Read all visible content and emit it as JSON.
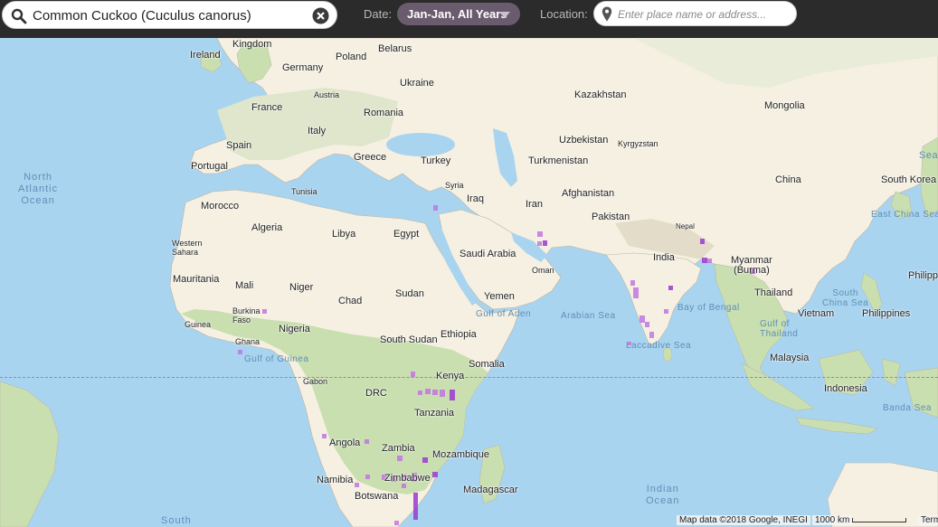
{
  "toolbar": {
    "species_value": "Common Cuckoo (Cuculus canorus)",
    "date_label": "Date:",
    "date_value": "Jan-Jan, All Years",
    "location_label": "Location:",
    "location_placeholder": "Enter place name or address..."
  },
  "map": {
    "labels": {
      "kingdom": "Kingdom",
      "ireland": "Ireland",
      "poland": "Poland",
      "belarus": "Belarus",
      "germany": "Germany",
      "ukraine": "Ukraine",
      "austria": "Austria",
      "kazakhstan": "Kazakhstan",
      "mongolia": "Mongolia",
      "france": "France",
      "romania": "Romania",
      "italy": "Italy",
      "uzbekistan": "Uzbekistan",
      "kyrgyzstan": "Kyrgyzstan",
      "spain": "Spain",
      "turkmenistan": "Turkmenistan",
      "portugal": "Portugal",
      "greece": "Greece",
      "turkey": "Turkey",
      "china": "China",
      "south_korea": "South Korea",
      "syria": "Syria",
      "tunisia": "Tunisia",
      "iraq": "Iraq",
      "afghanistan": "Afghanistan",
      "morocco": "Morocco",
      "iran": "Iran",
      "pakistan": "Pakistan",
      "algeria": "Algeria",
      "libya": "Libya",
      "egypt": "Egypt",
      "nepal": "Nepal",
      "western_sahara": "Western\nSahara",
      "saudi_arabia": "Saudi Arabia",
      "india": "India",
      "myanmar": "Myanmar\n(Burma)",
      "oman": "Oman",
      "mauritania": "Mauritania",
      "mali": "Mali",
      "niger": "Niger",
      "chad": "Chad",
      "sudan": "Sudan",
      "yemen": "Yemen",
      "thailand": "Thailand",
      "burkina_faso": "Burkina\nFaso",
      "nigeria": "Nigeria",
      "guinea": "Guinea",
      "vietnam": "Vietnam",
      "philippines": "Philippines",
      "ghana": "Ghana",
      "south_sudan": "South Sudan",
      "ethiopia": "Ethiopia",
      "somalia": "Somalia",
      "malaysia": "Malaysia",
      "gabon": "Gabon",
      "kenya": "Kenya",
      "drc": "DRC",
      "indonesia": "Indonesia",
      "tanzania": "Tanzania",
      "angola": "Angola",
      "zambia": "Zambia",
      "mozambique": "Mozambique",
      "namibia": "Namibia",
      "zimbabwe": "Zimbabwe",
      "madagascar": "Madagascar",
      "botswana": "Botswana",
      "philipp_edge": "Philipp",
      "sea_edge": "Sea"
    },
    "water_labels": {
      "north_atlantic": "North\nAtlantic\nOcean",
      "east_china_sea": "East China Sea",
      "gulf_of_aden": "Gulf of Aden",
      "arabian_sea": "Arabian Sea",
      "bay_of_bengal": "Bay of Bengal",
      "south_china_sea": "South\nChina Sea",
      "gulf_of_thailand": "Gulf of\nThailand",
      "laccadive_sea": "Laccadive Sea",
      "gulf_of_guinea": "Gulf of Guinea",
      "banda_sea": "Banda Sea",
      "indian_ocean": "Indian\nOcean",
      "south_edge": "South"
    },
    "attribution": "Map data ©2018 Google, INEGI",
    "scale": "1000 km",
    "terms": "Terms"
  },
  "colors": {
    "land": "#f5f0e1",
    "vegetation": "#c9dfb0",
    "water": "#a9d4f0",
    "observation": "#c176e0",
    "observation_dark": "#9b3ad0",
    "toolbar": "#2b2b2b",
    "date_pill": "#6b5b6e"
  },
  "icons": [
    "search-icon",
    "clear-icon",
    "caret-down-icon",
    "location-pin-icon"
  ]
}
